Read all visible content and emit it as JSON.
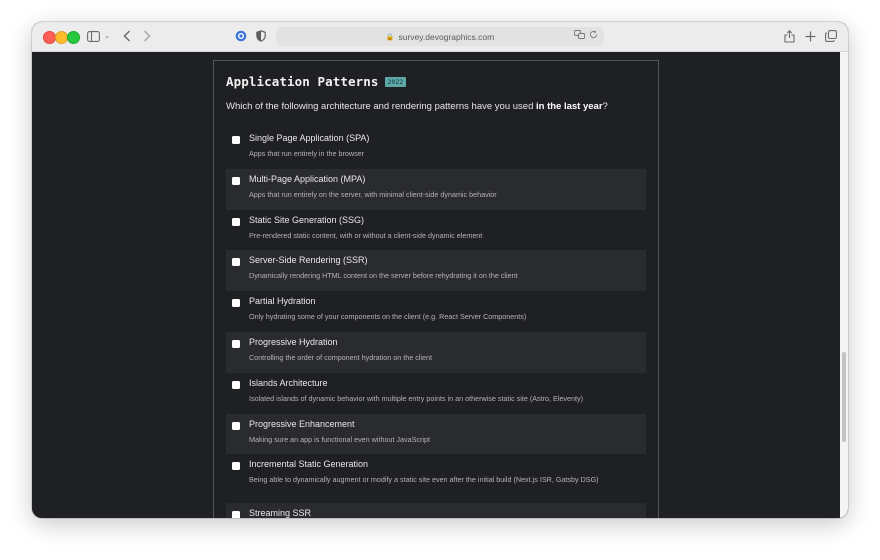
{
  "browser": {
    "url": "survey.devographics.com"
  },
  "section": {
    "title": "Application Patterns",
    "badge": "2022",
    "question_prefix": "Which of the following architecture and rendering patterns have you used ",
    "question_bold": "in the last year",
    "question_suffix": "?"
  },
  "options": [
    {
      "label": "Single Page Application (SPA)",
      "desc": "Apps that run entirely in the browser"
    },
    {
      "label": "Multi-Page Application (MPA)",
      "desc": "Apps that run entirely on the server, with minimal client-side dynamic behavior"
    },
    {
      "label": "Static Site Generation (SSG)",
      "desc": "Pre-rendered static content, with or without a client-side dynamic element"
    },
    {
      "label": "Server-Side Rendering (SSR)",
      "desc": "Dynamically rendering HTML content on the server before rehydrating it on the client"
    },
    {
      "label": "Partial Hydration",
      "desc": "Only hydrating some of your components on the client (e.g. React Server Components)"
    },
    {
      "label": "Progressive Hydration",
      "desc": "Controlling the order of component hydration on the client"
    },
    {
      "label": "Islands Architecture",
      "desc": "Isolated islands of dynamic behavior with multiple entry points in an otherwise static site (Astro, Eleventy)"
    },
    {
      "label": "Progressive Enhancement",
      "desc": "Making sure an app is functional even without JavaScript"
    },
    {
      "label": "Incremental Static Generation",
      "desc": "Being able to dynamically augment or modify a static site even after the initial build (Next.js ISR, Gatsby DSG)"
    },
    {
      "label": "Streaming SSR",
      "desc": ""
    }
  ],
  "colors": {
    "background": "#1f2023",
    "alt_row": "#2a2b2f",
    "badge": "#5fa8a8"
  }
}
